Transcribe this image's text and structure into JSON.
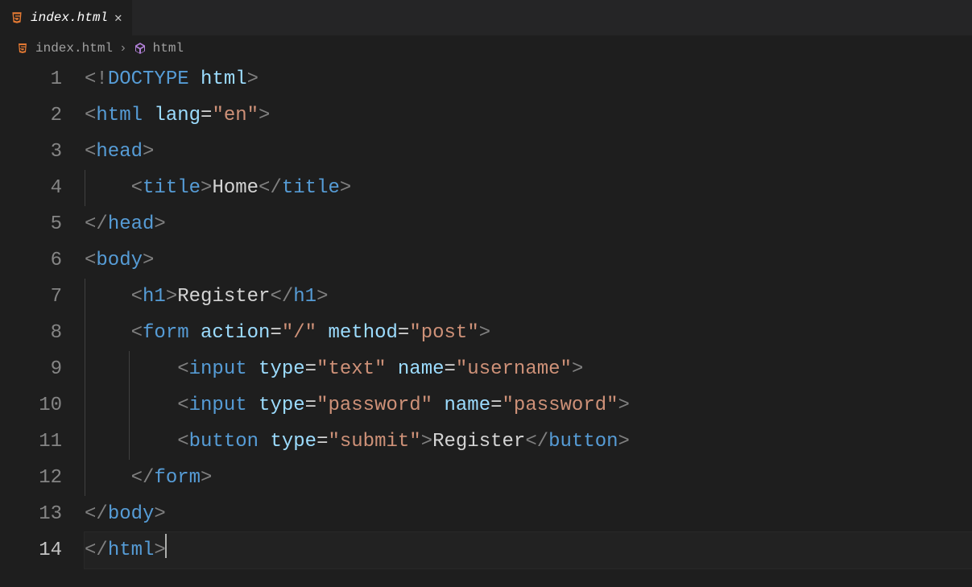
{
  "tab": {
    "filename": "index.html",
    "close_glyph": "✕"
  },
  "breadcrumb": {
    "file": "index.html",
    "separator": "›",
    "symbol": "html"
  },
  "line_numbers": [
    "1",
    "2",
    "3",
    "4",
    "5",
    "6",
    "7",
    "8",
    "9",
    "10",
    "11",
    "12",
    "13",
    "14"
  ],
  "active_line": 14,
  "code_lines": [
    {
      "indent": 0,
      "tokens": [
        [
          "p",
          "<!"
        ],
        [
          "doct",
          "DOCTYPE"
        ],
        [
          "txt",
          " "
        ],
        [
          "attr",
          "html"
        ],
        [
          "p",
          ">"
        ]
      ]
    },
    {
      "indent": 0,
      "tokens": [
        [
          "p",
          "<"
        ],
        [
          "tagn",
          "html"
        ],
        [
          "txt",
          " "
        ],
        [
          "attr",
          "lang"
        ],
        [
          "op",
          "="
        ],
        [
          "str",
          "\"en\""
        ],
        [
          "p",
          ">"
        ]
      ]
    },
    {
      "indent": 0,
      "tokens": [
        [
          "p",
          "<"
        ],
        [
          "tagn",
          "head"
        ],
        [
          "p",
          ">"
        ]
      ]
    },
    {
      "indent": 1,
      "tokens": [
        [
          "p",
          "<"
        ],
        [
          "tagn",
          "title"
        ],
        [
          "p",
          ">"
        ],
        [
          "txt",
          "Home"
        ],
        [
          "p",
          "</"
        ],
        [
          "tagn",
          "title"
        ],
        [
          "p",
          ">"
        ]
      ]
    },
    {
      "indent": 0,
      "tokens": [
        [
          "p",
          "</"
        ],
        [
          "tagn",
          "head"
        ],
        [
          "p",
          ">"
        ]
      ]
    },
    {
      "indent": 0,
      "tokens": [
        [
          "p",
          "<"
        ],
        [
          "tagn",
          "body"
        ],
        [
          "p",
          ">"
        ]
      ]
    },
    {
      "indent": 1,
      "tokens": [
        [
          "p",
          "<"
        ],
        [
          "tagn",
          "h1"
        ],
        [
          "p",
          ">"
        ],
        [
          "txt",
          "Register"
        ],
        [
          "p",
          "</"
        ],
        [
          "tagn",
          "h1"
        ],
        [
          "p",
          ">"
        ]
      ]
    },
    {
      "indent": 1,
      "tokens": [
        [
          "p",
          "<"
        ],
        [
          "tagn",
          "form"
        ],
        [
          "txt",
          " "
        ],
        [
          "attr",
          "action"
        ],
        [
          "op",
          "="
        ],
        [
          "str",
          "\"/\""
        ],
        [
          "txt",
          " "
        ],
        [
          "attr",
          "method"
        ],
        [
          "op",
          "="
        ],
        [
          "str",
          "\"post\""
        ],
        [
          "p",
          ">"
        ]
      ]
    },
    {
      "indent": 2,
      "tokens": [
        [
          "p",
          "<"
        ],
        [
          "tagn",
          "input"
        ],
        [
          "txt",
          " "
        ],
        [
          "attr",
          "type"
        ],
        [
          "op",
          "="
        ],
        [
          "str",
          "\"text\""
        ],
        [
          "txt",
          " "
        ],
        [
          "attr",
          "name"
        ],
        [
          "op",
          "="
        ],
        [
          "str",
          "\"username\""
        ],
        [
          "p",
          ">"
        ]
      ]
    },
    {
      "indent": 2,
      "tokens": [
        [
          "p",
          "<"
        ],
        [
          "tagn",
          "input"
        ],
        [
          "txt",
          " "
        ],
        [
          "attr",
          "type"
        ],
        [
          "op",
          "="
        ],
        [
          "str",
          "\"password\""
        ],
        [
          "txt",
          " "
        ],
        [
          "attr",
          "name"
        ],
        [
          "op",
          "="
        ],
        [
          "str",
          "\"password\""
        ],
        [
          "p",
          ">"
        ]
      ]
    },
    {
      "indent": 2,
      "tokens": [
        [
          "p",
          "<"
        ],
        [
          "tagn",
          "button"
        ],
        [
          "txt",
          " "
        ],
        [
          "attr",
          "type"
        ],
        [
          "op",
          "="
        ],
        [
          "str",
          "\"submit\""
        ],
        [
          "p",
          ">"
        ],
        [
          "txt",
          "Register"
        ],
        [
          "p",
          "</"
        ],
        [
          "tagn",
          "button"
        ],
        [
          "p",
          ">"
        ]
      ]
    },
    {
      "indent": 1,
      "tokens": [
        [
          "p",
          "</"
        ],
        [
          "tagn",
          "form"
        ],
        [
          "p",
          ">"
        ]
      ]
    },
    {
      "indent": 0,
      "tokens": [
        [
          "p",
          "</"
        ],
        [
          "tagn",
          "body"
        ],
        [
          "p",
          ">"
        ]
      ]
    },
    {
      "indent": 0,
      "tokens": [
        [
          "p",
          "</"
        ],
        [
          "tagn",
          "html"
        ],
        [
          "p",
          ">"
        ]
      ]
    }
  ]
}
